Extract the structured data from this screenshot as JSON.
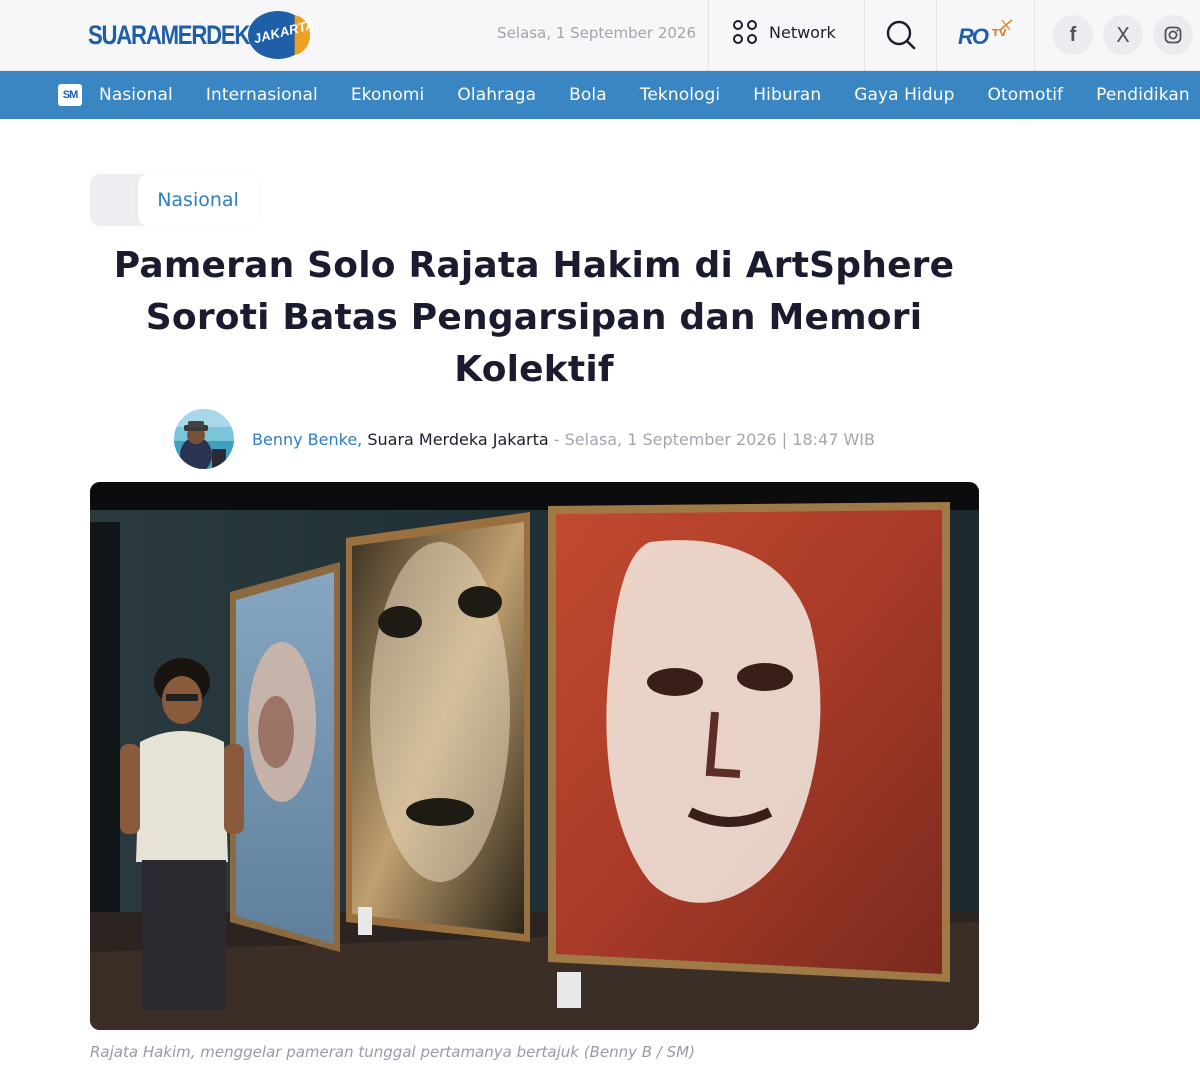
{
  "header": {
    "logo": "SUARAMERDEKA",
    "logo_badge": "JAKARTA",
    "date": "Selasa, 1 September 2026",
    "network_label": "Network",
    "rotv_logo": "RO",
    "rotv_tv": "TV"
  },
  "social": {
    "facebook": "f",
    "x": "X",
    "instagram": "instagram-icon"
  },
  "nav": {
    "home_logo": "SM",
    "items": [
      {
        "label": "Nasional"
      },
      {
        "label": "Internasional"
      },
      {
        "label": "Ekonomi"
      },
      {
        "label": "Olahraga"
      },
      {
        "label": "Bola"
      },
      {
        "label": "Teknologi"
      },
      {
        "label": "Hiburan"
      },
      {
        "label": "Gaya Hidup"
      },
      {
        "label": "Otomotif"
      },
      {
        "label": "Pendidikan"
      }
    ]
  },
  "article": {
    "category": "Nasional",
    "title": "Pameran Solo Rajata Hakim di ArtSphere Soroti Batas Pengarsipan dan Memori Kolektif",
    "author": "Benny Benke,",
    "outlet": " Suara Merdeka Jakarta",
    "datetime": " - Selasa, 1 September 2026 | 18:47 WIB",
    "caption": "Rajata Hakim, menggelar pameran tunggal pertamanya bertajuk (Benny B / SM)"
  },
  "colors": {
    "brand_blue": "#1f5fa8",
    "nav_blue": "#3a86c3",
    "link_blue": "#2d7fc0",
    "muted": "#a4a4b0"
  }
}
